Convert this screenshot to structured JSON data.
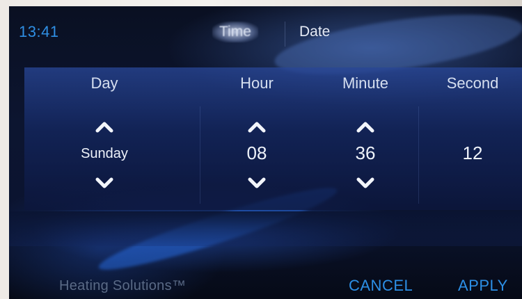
{
  "status": {
    "time": "13:41"
  },
  "tabs": [
    {
      "label": "Time",
      "active": true
    },
    {
      "label": "Date",
      "active": false
    }
  ],
  "columns": [
    {
      "label": "Day",
      "value": "Sunday",
      "adjustable": true
    },
    {
      "label": "Hour",
      "value": "08",
      "adjustable": true
    },
    {
      "label": "Minute",
      "value": "36",
      "adjustable": true
    },
    {
      "label": "Second",
      "value": "12",
      "adjustable": false
    }
  ],
  "footer": {
    "brand": "Heating Solutions™",
    "cancel_label": "CANCEL",
    "apply_label": "APPLY"
  },
  "icons": {
    "increase": "chevron-up-icon",
    "decrease": "chevron-down-icon"
  },
  "colors": {
    "accent": "#2c8fe6",
    "background": "#0b1430",
    "panel": "#1f3a82",
    "text": "#e6ebf6"
  }
}
